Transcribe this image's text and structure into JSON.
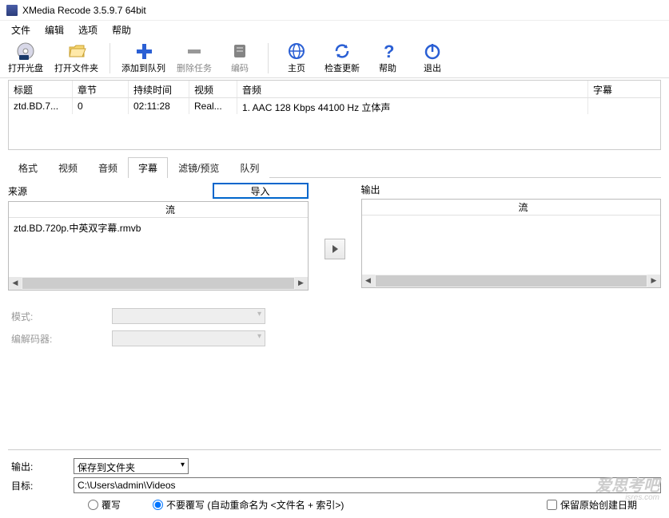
{
  "window": {
    "title": "XMedia Recode 3.5.9.7 64bit"
  },
  "menu": {
    "file": "文件",
    "edit": "编辑",
    "options": "选项",
    "help": "帮助"
  },
  "toolbar": {
    "open_disc": "打开光盘",
    "open_folder": "打开文件夹",
    "add_queue": "添加到队列",
    "remove": "删除任务",
    "encode": "编码",
    "home": "主页",
    "check_update": "检查更新",
    "help": "帮助",
    "quit": "退出"
  },
  "grid": {
    "headers": {
      "title": "标题",
      "chapter": "章节",
      "duration": "持续时间",
      "video": "视频",
      "audio": "音频",
      "subtitle": "字幕"
    },
    "rows": [
      {
        "title": "ztd.BD.7...",
        "chapter": "0",
        "duration": "02:11:28",
        "video": "Real...",
        "audio": "1. AAC  128 Kbps 44100 Hz 立体声",
        "subtitle": ""
      }
    ]
  },
  "tabs": {
    "format": "格式",
    "video": "视频",
    "audio": "音频",
    "subtitle": "字幕",
    "filter": "滤镜/预览",
    "queue": "队列"
  },
  "subtitle_panel": {
    "source": "来源",
    "import": "导入",
    "output": "输出",
    "stream": "流",
    "source_item": "ztd.BD.720p.中英双字幕.rmvb",
    "mode_label": "模式:",
    "codec_label": "编解码器:"
  },
  "bottom": {
    "output_label": "输出:",
    "output_mode": "保存到文件夹",
    "target_label": "目标:",
    "target_path": "C:\\Users\\admin\\Videos",
    "overwrite": "覆写",
    "no_overwrite": "不要覆写 (自动重命名为 <文件名 + 索引>)",
    "keep_date": "保留原始创建日期"
  },
  "watermark": {
    "line1": "爱思考吧",
    "line2": "isres.com"
  }
}
